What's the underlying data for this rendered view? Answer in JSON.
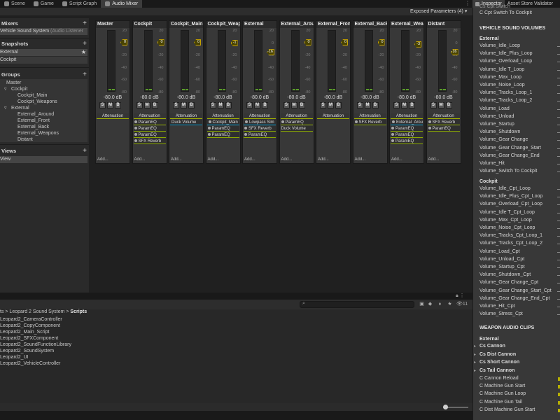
{
  "tabs": [
    {
      "label": "Scene",
      "active": false
    },
    {
      "label": "Game",
      "active": false
    },
    {
      "label": "Script Graph",
      "active": false
    },
    {
      "label": "Audio Mixer",
      "active": true
    }
  ],
  "exposed_parameters": "Exposed Parameters (4)",
  "sidebar": {
    "mixers_title": "Mixers",
    "mixer_name": "Vehicle Sound System",
    "mixer_listener": "(Audio Listener",
    "snapshots_title": "Snapshots",
    "snapshots": [
      "External",
      "Cockpit"
    ],
    "groups_title": "Groups",
    "groups": [
      "Master",
      "Cockpit",
      "Cockpit_Main",
      "Cockpit_Weapons",
      "External",
      "External_Around",
      "External_Front",
      "External_Back",
      "External_Weapons",
      "Distant"
    ],
    "views_title": "Views",
    "views": [
      "View"
    ]
  },
  "strip_common": {
    "db": "-80.0 dB",
    "solo": "S",
    "mute": "M",
    "bypass": "B",
    "attenuation": "Attenuation",
    "add": "Add...",
    "scale": [
      "20",
      "0",
      "-20",
      "-40",
      "-60",
      "-80"
    ]
  },
  "strips": [
    {
      "name": "Master",
      "knob": "0",
      "effects": []
    },
    {
      "name": "Cockpit",
      "knob": "0",
      "effects": [
        "ParamEQ",
        "ParamEQ",
        "ParamEQ",
        "SFX Reverb"
      ]
    },
    {
      "name": "Cockpit_Main",
      "knob": "0",
      "effects": [
        "Duck Volume"
      ]
    },
    {
      "name": "Cockpit_Weap",
      "knob": "-1",
      "effects": [
        "Cockpit_Main",
        "ParamEQ",
        "ParamEQ"
      ]
    },
    {
      "name": "External",
      "knob": "-16",
      "effects": [
        "Lowpass Sim",
        "SFX Reverb",
        "ParamEQ"
      ]
    },
    {
      "name": "External_Arou",
      "knob": "0",
      "effects": [
        "ParamEQ",
        "Duck Volume"
      ]
    },
    {
      "name": "External_Fron",
      "knob": "0",
      "effects": []
    },
    {
      "name": "External_Back",
      "knob": "0",
      "effects": [
        "SFX Reverb"
      ]
    },
    {
      "name": "External_Wea",
      "knob": "-3",
      "effects": [
        "External_Arou",
        "ParamEQ",
        "ParamEQ",
        "ParamEQ"
      ]
    },
    {
      "name": "Distant",
      "knob": "-16",
      "effects": [
        "SFX Reverb",
        "ParamEQ"
      ]
    }
  ],
  "project": {
    "breadcrumb_prefix": "ts > Leopard 2 Sound System >",
    "breadcrumb_current": "Scripts",
    "item_count": "11",
    "files": [
      "Leopard2_CameraController",
      "Leopard2_CopyComponent",
      "Leopard2_Main_Script",
      "Leopard2_SFXComponent",
      "Leopard2_SoundFunctionLibrary",
      "Leopard2_SoundSystem",
      "Leopard2_UI",
      "Leopard2_VehicleController"
    ]
  },
  "inspector": {
    "tabs": [
      {
        "label": "Inspector",
        "active": true
      },
      {
        "label": "Asset Store Validator",
        "active": false
      }
    ],
    "cut_top": "Cs Cpt Switch",
    "first_item": "C Cpt Switch To Cockpit",
    "section_volumes": "VEHICLE SOUND VOLUMES",
    "external_label": "External",
    "external_items": [
      "Volume_Idle_Loop",
      "Volume_Idle_Plus_Loop",
      "Volume_Overload_Loop",
      "Volume_Idle T_Loop",
      "Volume_Max_Loop",
      "Volume_Noise_Loop",
      "Volume_Tracks_Loop_1",
      "Volume_Tracks_Loop_2",
      "Volume_Load",
      "Volume_Unload",
      "Volume_Startup",
      "Volume_Shutdown",
      "Volume_Gear Change",
      "Volume_Gear Change_Start",
      "Volume_Gear Change_End",
      "Volume_Hit",
      "Volume_Switch To Cockpit"
    ],
    "cockpit_label": "Cockpit",
    "cockpit_items": [
      "Volume_Idle_Cpt_Loop",
      "Volume_Idle_Plus_Cpt_Loop",
      "Volume_Overload_Cpt_Loop",
      "Volume_Idle T_Cpt_Loop",
      "Volume_Max_Cpt_Loop",
      "Volume_Noise_Cpt_Loop",
      "Volume_Tracks_Cpt_Loop_1",
      "Volume_Tracks_Cpt_Loop_2",
      "Volume_Load_Cpt",
      "Volume_Unload_Cpt",
      "Volume_Startup_Cpt",
      "Volume_Shutdown_Cpt",
      "Volume_Gear Change_Cpt",
      "Volume_Gear Change_Start_Cpt",
      "Volume_Gear Change_End_Cpt",
      "Volume_Hit_Cpt",
      "Volume_Stress_Cpt"
    ],
    "section_weapon": "WEAPON AUDIO CLIPS",
    "weapon_label": "External",
    "weapon_groups": [
      "Cs Cannon",
      "Cs Dist Cannon",
      "Cs Short Cannon",
      "Cs Tail Cannon"
    ],
    "weapon_items": [
      "C Cannon Reload",
      "C Machine Gun Start",
      "C Machine Gun Loop",
      "C Machine Gun Tail",
      "C Dist Machine Gun Start"
    ]
  }
}
